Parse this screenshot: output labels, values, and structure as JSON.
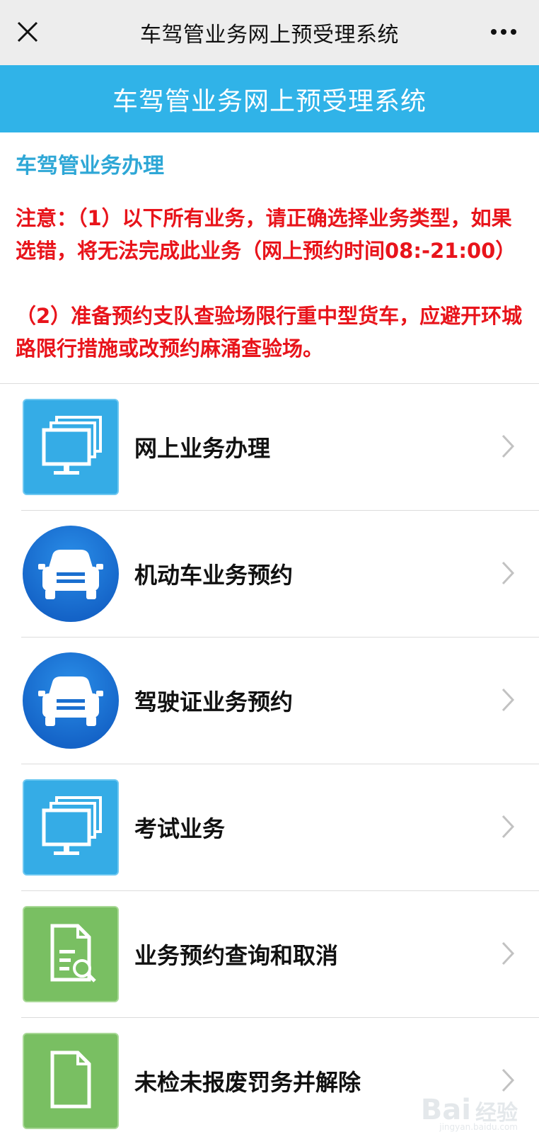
{
  "topbar": {
    "title": "车驾管业务网上预受理系统",
    "close_icon": "close-icon",
    "more_icon": "more-icon"
  },
  "header": {
    "title": "车驾管业务网上预受理系统",
    "color": "#30b3e8"
  },
  "section_title": "车驾管业务办理",
  "notice": {
    "line1": "注意：（1）以下所有业务，请正确选择业务类型，如果选错，将无法完成此业务（网上预约时间08:-21:00）",
    "line2": "（2）准备预约支队查验场限行重中型货车，应避开环城路限行措施或改预约麻涌查验场。",
    "color": "#e8141b"
  },
  "menu": [
    {
      "label": "网上业务办理",
      "icon": "monitor-stack-icon"
    },
    {
      "label": "机动车业务预约",
      "icon": "car-icon"
    },
    {
      "label": "驾驶证业务预约",
      "icon": "car-icon"
    },
    {
      "label": "考试业务",
      "icon": "monitor-stack-icon"
    },
    {
      "label": "业务预约查询和取消",
      "icon": "document-search-icon"
    },
    {
      "label": "未检未报废罚务并解除",
      "icon": "document-icon"
    }
  ],
  "watermark": {
    "logo": "Bai",
    "text": "经验",
    "sub": "jingyan.baidu.com"
  }
}
